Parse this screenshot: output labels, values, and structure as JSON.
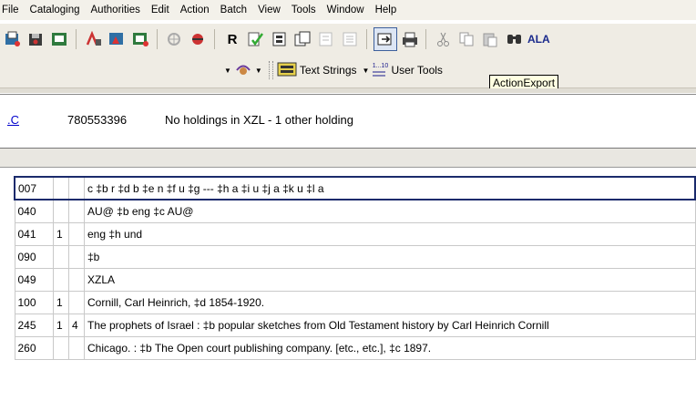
{
  "menu": [
    "File",
    "Cataloging",
    "Authorities",
    "Edit",
    "Action",
    "Batch",
    "View",
    "Tools",
    "Window",
    "Help"
  ],
  "toolbar1": {
    "icons": [
      "new-record-icon",
      "save-record-icon",
      "replace-record-icon",
      "validate-icon",
      "delete-record-icon",
      "copy-record-icon",
      "flag-icon",
      "produce-icon",
      "reformat-icon",
      "reference-icon",
      "export-record-icon",
      "print-icon",
      "cut-icon",
      "copy-icon",
      "paste-icon",
      "find-icon"
    ],
    "reformat_label": "R",
    "trailing_label": "ALA"
  },
  "toolbar2": {
    "text_strings_label": "Text Strings",
    "user_tools_label": "User Tools",
    "user_tools_icon_text": "1...10"
  },
  "tooltip": "ActionExport",
  "record_info": {
    "link_text": ".C",
    "ocn": "780553396",
    "holdings_text": "No holdings in XZL - 1 other holding"
  },
  "fields": [
    {
      "tag": "007",
      "ind1": "",
      "ind2": "",
      "data": "c ‡b r ‡d b ‡e n ‡f u ‡g --- ‡h a ‡i u ‡j a ‡k u ‡l a"
    },
    {
      "tag": "040",
      "ind1": "",
      "ind2": "",
      "data": "AU@ ‡b eng ‡c AU@"
    },
    {
      "tag": "041",
      "ind1": "1",
      "ind2": "",
      "data": "eng ‡h und"
    },
    {
      "tag": "090",
      "ind1": "",
      "ind2": "",
      "data": "‡b"
    },
    {
      "tag": "049",
      "ind1": "",
      "ind2": "",
      "data": "XZLA"
    },
    {
      "tag": "100",
      "ind1": "1",
      "ind2": "",
      "data": "Cornill, Carl Heinrich, ‡d 1854-1920."
    },
    {
      "tag": "245",
      "ind1": "1",
      "ind2": "4",
      "data": "The prophets of Israel : ‡b popular sketches from Old Testament history by Carl Heinrich Cornill"
    },
    {
      "tag": "260",
      "ind1": "",
      "ind2": "",
      "data": "Chicago. : ‡b The Open court publishing company. [etc., etc.], ‡c 1897."
    }
  ],
  "colors": {
    "chrome": "#efece4",
    "selected_row_border": "#1a2a6c",
    "link": "#0000cc",
    "tooltip_bg": "#ffffe1"
  }
}
